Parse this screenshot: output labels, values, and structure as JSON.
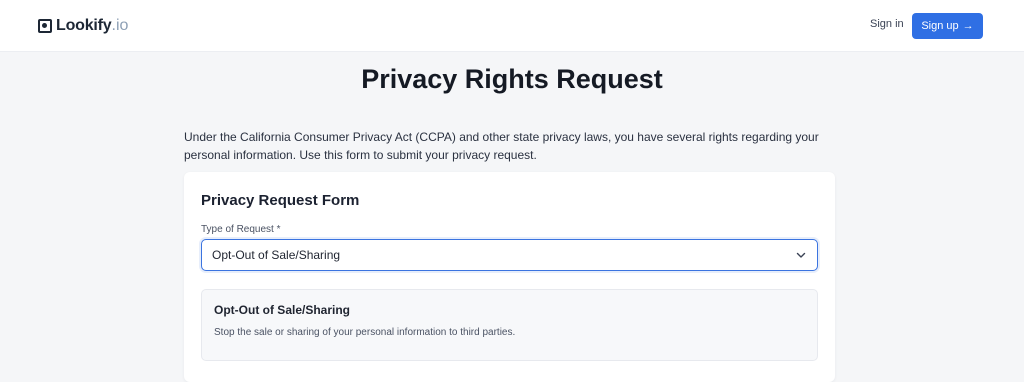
{
  "header": {
    "logo_name": "Lookify",
    "logo_tld": ".io",
    "signin_label": "Sign in",
    "signup_label": "Sign up",
    "signup_arrow": "→"
  },
  "page": {
    "title": "Privacy Rights Request",
    "intro": "Under the California Consumer Privacy Act (CCPA) and other state privacy laws, you have several rights regarding your personal information. Use this form to submit your privacy request."
  },
  "form": {
    "title": "Privacy Request Form",
    "type_label": "Type of Request *",
    "type_value": "Opt-Out of Sale/Sharing",
    "info_title": "Opt-Out of Sale/Sharing",
    "info_description": "Stop the sale or sharing of your personal information to third parties."
  },
  "colors": {
    "accent": "#2f6fe4",
    "background": "#f5f6f8"
  },
  "icons": {
    "logo": "logo-mark-icon",
    "signup": "arrow-right-icon",
    "select": "chevron-down-icon"
  }
}
